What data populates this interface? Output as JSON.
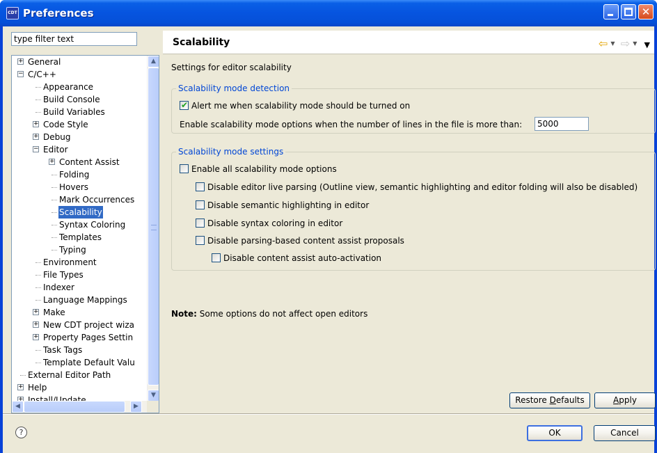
{
  "window": {
    "title": "Preferences",
    "app_icon_text": "CDT",
    "close_glyph": "✕"
  },
  "filter": {
    "placeholder": "type filter text",
    "value": "type filter text"
  },
  "tree": {
    "items": [
      {
        "label": "General",
        "expander": "+",
        "depth": 0
      },
      {
        "label": "C/C++",
        "expander": "-",
        "depth": 0
      },
      {
        "label": "Appearance",
        "expander": "",
        "depth": 1
      },
      {
        "label": "Build Console",
        "expander": "",
        "depth": 1
      },
      {
        "label": "Build Variables",
        "expander": "",
        "depth": 1
      },
      {
        "label": "Code Style",
        "expander": "+",
        "depth": 1
      },
      {
        "label": "Debug",
        "expander": "+",
        "depth": 1
      },
      {
        "label": "Editor",
        "expander": "-",
        "depth": 1
      },
      {
        "label": "Content Assist",
        "expander": "+",
        "depth": 2
      },
      {
        "label": "Folding",
        "expander": "",
        "depth": 2
      },
      {
        "label": "Hovers",
        "expander": "",
        "depth": 2
      },
      {
        "label": "Mark Occurrences",
        "expander": "",
        "depth": 2
      },
      {
        "label": "Scalability",
        "expander": "",
        "depth": 2,
        "selected": true
      },
      {
        "label": "Syntax Coloring",
        "expander": "",
        "depth": 2
      },
      {
        "label": "Templates",
        "expander": "",
        "depth": 2
      },
      {
        "label": "Typing",
        "expander": "",
        "depth": 2
      },
      {
        "label": "Environment",
        "expander": "",
        "depth": 1
      },
      {
        "label": "File Types",
        "expander": "",
        "depth": 1
      },
      {
        "label": "Indexer",
        "expander": "",
        "depth": 1
      },
      {
        "label": "Language Mappings",
        "expander": "",
        "depth": 1
      },
      {
        "label": "Make",
        "expander": "+",
        "depth": 1
      },
      {
        "label": "New CDT project wiza",
        "expander": "+",
        "depth": 1
      },
      {
        "label": "Property Pages Settin",
        "expander": "+",
        "depth": 1
      },
      {
        "label": "Task Tags",
        "expander": "",
        "depth": 1
      },
      {
        "label": "Template Default Valu",
        "expander": "",
        "depth": 1
      },
      {
        "label": "External Editor Path",
        "expander": "",
        "depth": 0
      },
      {
        "label": "Help",
        "expander": "+",
        "depth": 0
      },
      {
        "label": "Install/Update",
        "expander": "+",
        "depth": 0
      }
    ],
    "scroll_up": "▲",
    "scroll_down": "▼",
    "scroll_left": "◀",
    "scroll_right": "▶"
  },
  "page": {
    "title": "Scalability",
    "description": "Settings for editor scalability",
    "nav": {
      "back": "⇦",
      "forward": "⇨",
      "caret": "▼",
      "menu": "▼"
    },
    "detection_group": {
      "legend": "Scalability mode detection",
      "alert_label": "Alert me when scalability mode should be turned on",
      "alert_checked": true,
      "lines_label": "Enable scalability mode options when the number of lines in the file is more than:",
      "lines_value": "5000"
    },
    "settings_group": {
      "legend": "Scalability mode settings",
      "options": [
        {
          "label": "Enable all scalability mode options",
          "checked": false
        },
        {
          "label": "Disable editor live parsing (Outline view, semantic highlighting and editor folding will also be disabled)",
          "checked": false
        },
        {
          "label": "Disable semantic highlighting in editor",
          "checked": false
        },
        {
          "label": "Disable syntax coloring in editor",
          "checked": false
        },
        {
          "label": "Disable parsing-based content assist proposals",
          "checked": false
        },
        {
          "label": "Disable content assist auto-activation",
          "checked": false
        }
      ]
    },
    "note_bold": "Note:",
    "note_text": " Some options do not affect open editors"
  },
  "buttons": {
    "restore_prefix": "Restore ",
    "restore_underline": "D",
    "restore_suffix": "efaults",
    "apply_underline": "A",
    "apply_suffix": "pply",
    "ok": "OK",
    "cancel": "Cancel"
  },
  "help_icon": "?"
}
